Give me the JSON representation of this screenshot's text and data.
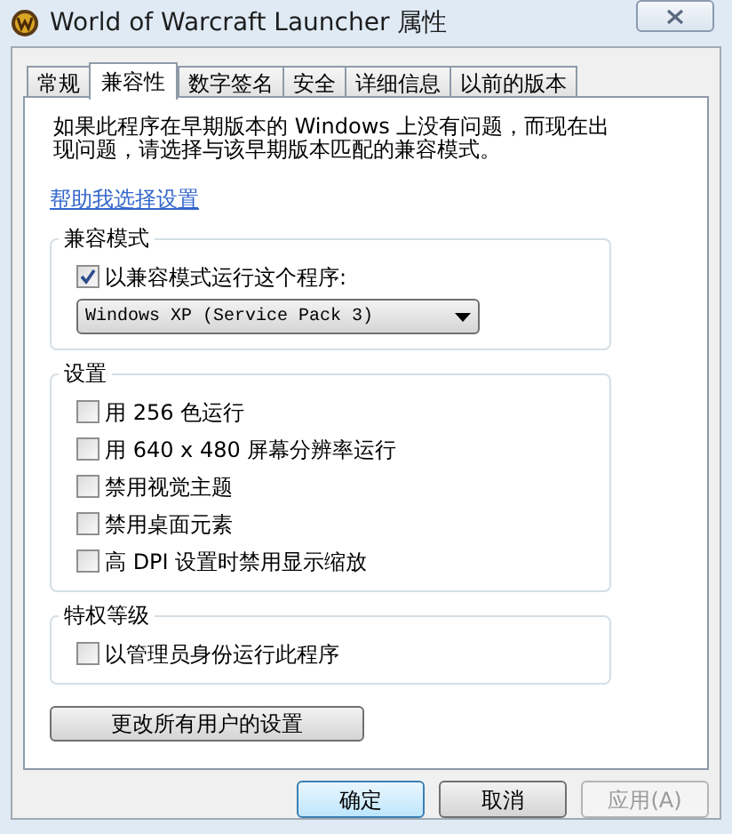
{
  "window": {
    "title": "World of Warcraft Launcher 属性"
  },
  "tabs": [
    {
      "label": "常规",
      "selected": false
    },
    {
      "label": "兼容性",
      "selected": true
    },
    {
      "label": "数字签名",
      "selected": false
    },
    {
      "label": "安全",
      "selected": false
    },
    {
      "label": "详细信息",
      "selected": false
    },
    {
      "label": "以前的版本",
      "selected": false
    }
  ],
  "intro": "如果此程序在早期版本的 Windows 上没有问题，而现在出现问题，请选择与该早期版本匹配的兼容模式。",
  "help_link": "帮助我选择设置",
  "groups": [
    {
      "title": "兼容模式",
      "options": [
        {
          "label": "以兼容模式运行这个程序:",
          "checked": true
        }
      ],
      "dropdown": {
        "value": "Windows XP (Service Pack 3)"
      }
    },
    {
      "title": "设置",
      "options": [
        {
          "label": "用 256 色运行",
          "checked": false
        },
        {
          "label": "用 640 x 480 屏幕分辨率运行",
          "checked": false
        },
        {
          "label": "禁用视觉主题",
          "checked": false
        },
        {
          "label": "禁用桌面元素",
          "checked": false
        },
        {
          "label": "高 DPI 设置时禁用显示缩放",
          "checked": false
        }
      ]
    },
    {
      "title": "特权等级",
      "options": [
        {
          "label": "以管理员身份运行此程序",
          "checked": false
        }
      ]
    }
  ],
  "change_all_button": "更改所有用户的设置",
  "buttons": [
    {
      "label": "确定",
      "default": true,
      "disabled": false
    },
    {
      "label": "取消",
      "default": false,
      "disabled": false
    },
    {
      "label": "应用(A)",
      "default": false,
      "disabled": true
    }
  ]
}
